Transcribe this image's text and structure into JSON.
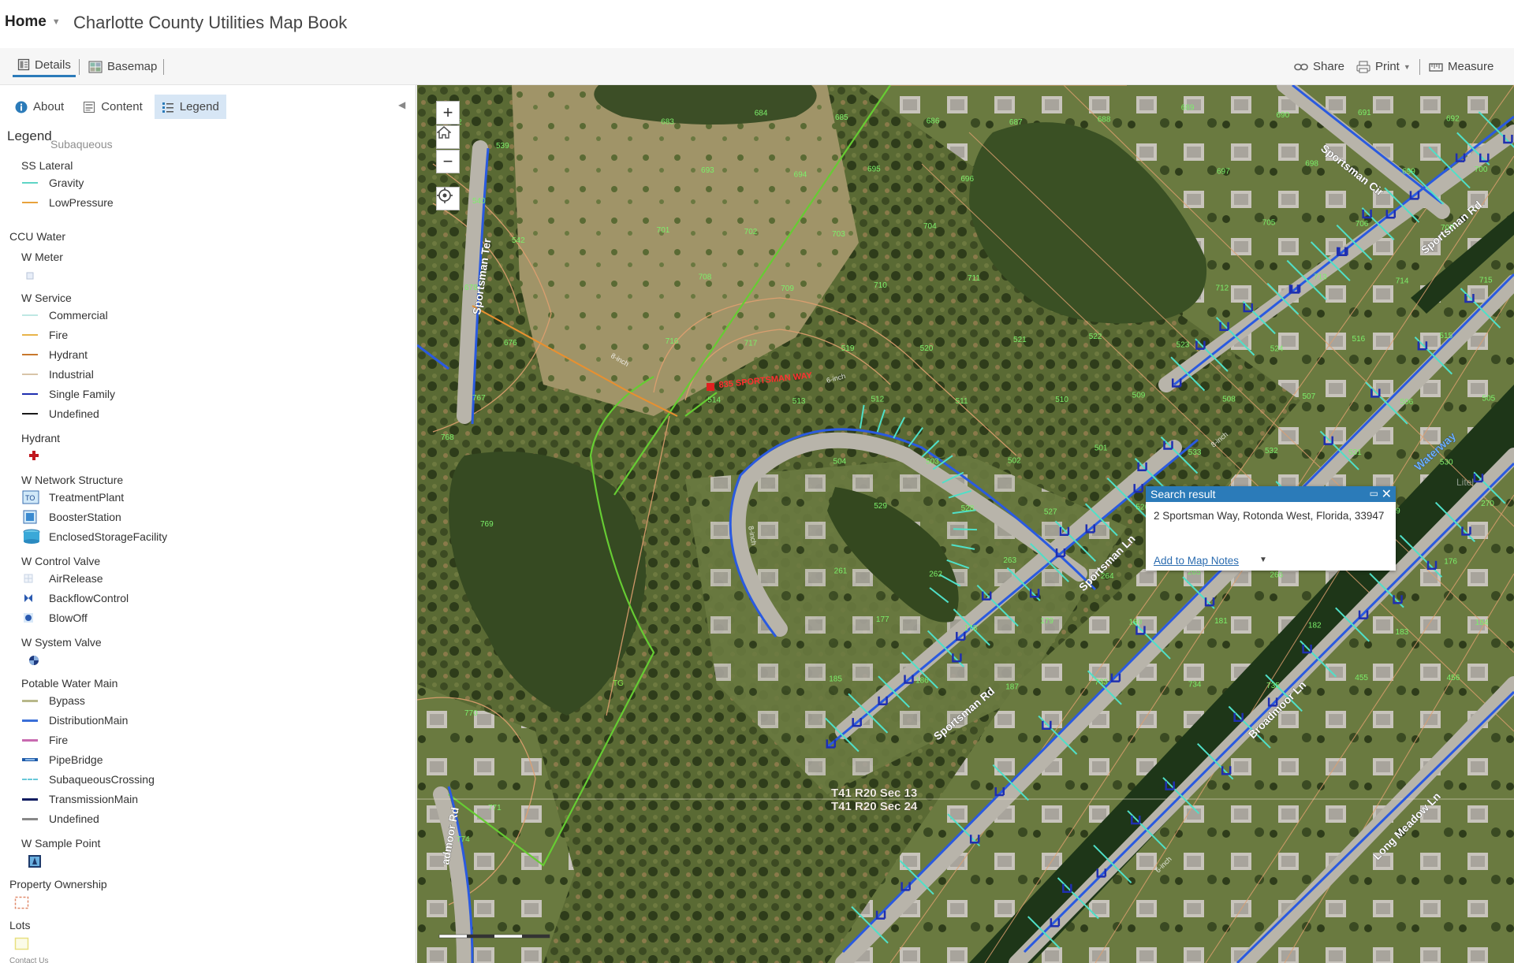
{
  "header": {
    "home_label": "Home",
    "title": "Charlotte County Utilities Map Book"
  },
  "toolbar": {
    "details": "Details",
    "basemap": "Basemap",
    "share": "Share",
    "print": "Print",
    "measure": "Measure"
  },
  "panel": {
    "tabs": [
      "About",
      "Content",
      "Legend"
    ],
    "active_tab": "Legend",
    "heading": "Legend",
    "cut_off_label": "Subaqueous",
    "footer_cut_text": "Contact Us"
  },
  "legend": {
    "ss_lateral": {
      "title": "SS Lateral",
      "items": [
        {
          "label": "Gravity",
          "color": "#5fd5c6"
        },
        {
          "label": "LowPressure",
          "color": "#e8a23c"
        }
      ]
    },
    "ccu_water": "CCU Water",
    "w_meter": "W Meter",
    "w_service": {
      "title": "W Service",
      "items": [
        {
          "label": "Commercial",
          "color": "#bfe8e4"
        },
        {
          "label": "Fire",
          "color": "#e8b44a"
        },
        {
          "label": "Hydrant",
          "color": "#c8782c"
        },
        {
          "label": "Industrial",
          "color": "#d8c4a8"
        },
        {
          "label": "Single Family",
          "color": "#1f2fb0"
        },
        {
          "label": "Undefined",
          "color": "#1a1a1a"
        }
      ]
    },
    "hydrant": "Hydrant",
    "w_network": {
      "title": "W Network Structure",
      "items": [
        {
          "label": "TreatmentPlant",
          "icon": "treatment-plant-icon"
        },
        {
          "label": "BoosterStation",
          "icon": "booster-station-icon"
        },
        {
          "label": "EnclosedStorageFacility",
          "icon": "storage-tank-icon"
        }
      ]
    },
    "w_control_valve": {
      "title": "W Control Valve",
      "items": [
        {
          "label": "AirRelease",
          "icon": "air-release-icon"
        },
        {
          "label": "BackflowControl",
          "icon": "backflow-icon"
        },
        {
          "label": "BlowOff",
          "icon": "blowoff-icon"
        }
      ]
    },
    "w_system_valve": "W System Valve",
    "potable_main": {
      "title": "Potable Water Main",
      "items": [
        {
          "label": "Bypass",
          "color": "#b8b88a"
        },
        {
          "label": "DistributionMain",
          "color": "#3a6fd8"
        },
        {
          "label": "Fire",
          "color": "#c86ab0"
        },
        {
          "label": "PipeBridge",
          "color": "#1e5aa8"
        },
        {
          "label": "SubaqueousCrossing",
          "color": "#68c8d8"
        },
        {
          "label": "TransmissionMain",
          "color": "#0f1c60"
        },
        {
          "label": "Undefined",
          "color": "#888888"
        }
      ]
    },
    "w_sample_point": "W Sample Point",
    "property_ownership": "Property Ownership",
    "lots": "Lots"
  },
  "map": {
    "street_labels": [
      "Sportsman Ter",
      "Sportsman Cir",
      "Sportsman Rd",
      "Sportsman Rd",
      "Sportsman Ln",
      "Broadmoor Ln",
      "Long Meadow Ln",
      "admoor Rd"
    ],
    "address_marker": "835 SPORTSMAN WAY",
    "section_labels": [
      "T41 R20 Sec 13",
      "T41 R20 Sec 24"
    ],
    "waterway_label": "Waterway",
    "lot_numbers": [
      "774",
      "771",
      "770",
      "769",
      "768",
      "767",
      "676",
      "678",
      "542",
      "540",
      "539",
      "682",
      "683",
      "684",
      "685",
      "686",
      "687",
      "688",
      "689",
      "690",
      "691",
      "692",
      "693",
      "694",
      "695",
      "696",
      "697",
      "698",
      "699",
      "700",
      "701",
      "702",
      "703",
      "704",
      "705",
      "706",
      "707",
      "708",
      "709",
      "710",
      "711",
      "712",
      "713",
      "714",
      "715",
      "716",
      "717",
      "519",
      "520",
      "521",
      "522",
      "523",
      "524",
      "516",
      "515",
      "514",
      "513",
      "512",
      "511",
      "510",
      "509",
      "508",
      "507",
      "506",
      "505",
      "504",
      "503",
      "502",
      "501",
      "533",
      "532",
      "531",
      "530",
      "529",
      "528",
      "527",
      "526",
      "525",
      "268",
      "269",
      "270",
      "261",
      "262",
      "263",
      "264",
      "265",
      "266",
      "267",
      "176",
      "177",
      "178",
      "179",
      "180",
      "181",
      "182",
      "183",
      "184",
      "185",
      "186",
      "187",
      "733",
      "734",
      "735",
      "455",
      "456"
    ],
    "pipe_size_labels": [
      "8-inch",
      "6-inch",
      "8-inch",
      "8-inch",
      "6-inch"
    ],
    "other_labels": [
      "TG",
      "Litel"
    ]
  },
  "popup": {
    "title": "Search result",
    "address": "2 Sportsman Way, Rotonda West, Florida, 33947",
    "link": "Add to Map Notes"
  },
  "colors": {
    "accent": "#2b7bb9",
    "tab_active_bg": "#d7e6f5",
    "parcel": "#e0a070",
    "main": "#2a5ae0",
    "lateral": "#4fe0c8"
  }
}
